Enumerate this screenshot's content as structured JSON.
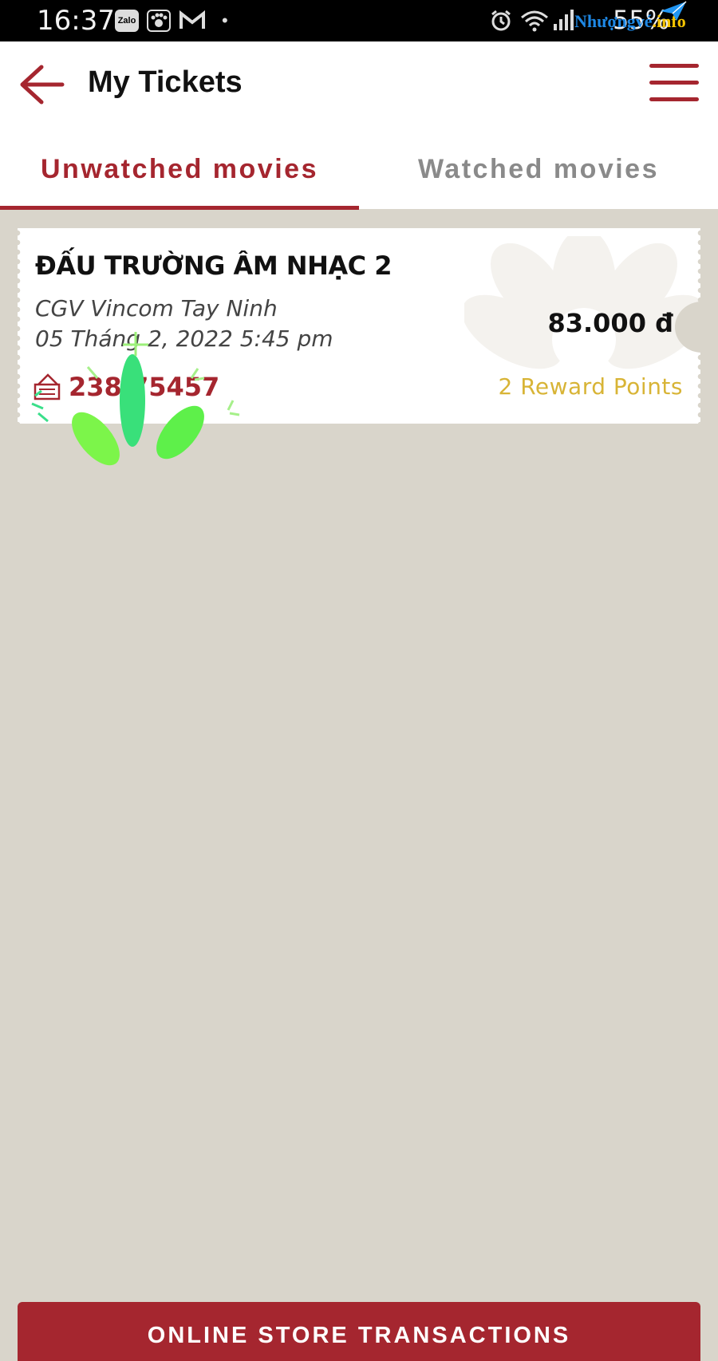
{
  "status_bar": {
    "time": "16:37",
    "battery": "55%",
    "notification_icons": [
      "zalo-icon",
      "paw-app-icon",
      "gmail-icon",
      "dot-icon"
    ],
    "system_icons": [
      "alarm-icon",
      "wifi-icon",
      "signal-icon"
    ],
    "zalo_label": "Zalo",
    "watermark": {
      "part1": "Nhượngvé",
      "part2": ".info"
    }
  },
  "header": {
    "title": "My Tickets",
    "back_icon": "arrow-left-icon",
    "menu_icon": "hamburger-menu-icon",
    "accent_color": "#a5262f"
  },
  "tabs": [
    {
      "label": "Unwatched movies",
      "active": true
    },
    {
      "label": "Watched movies",
      "active": false
    }
  ],
  "tickets": [
    {
      "movie_title": "ĐẤU TRƯỜNG ÂM NHẠC 2",
      "cinema": "CGV Vincom Tay Ninh",
      "showtime": "05 Tháng 2, 2022 5:45 pm",
      "price": "83.000 đ",
      "booking_code": "238 75457",
      "reward": "2 Reward Points",
      "reward_color": "#d8b436"
    }
  ],
  "bottom_button": {
    "label": "ONLINE STORE TRANSACTIONS"
  },
  "colors": {
    "background": "#d9d5cb",
    "accent": "#a5262f"
  }
}
